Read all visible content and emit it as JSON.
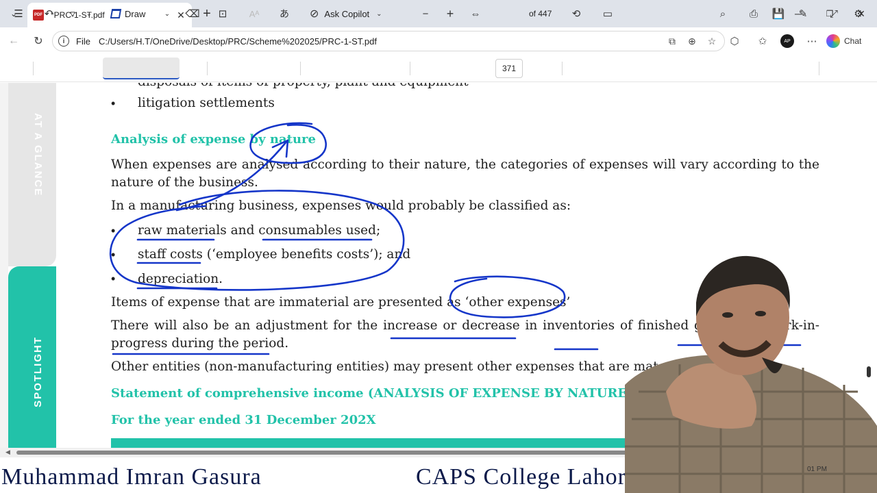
{
  "browser": {
    "tab_title": "*PRC-1-ST.pdf",
    "favicon_text": "PDF",
    "address_label": "File",
    "url": "C:/Users/H.T/OneDrive/Desktop/PRC/Scheme%202025/PRC-1-ST.pdf",
    "chat_label": "Chat",
    "profile_initials": "AP"
  },
  "toolbar": {
    "draw_label": "Draw",
    "copilot_label": "Ask Copilot",
    "current_page": "371",
    "page_total": "of 447"
  },
  "sidebar": {
    "top_label": "AT A GLANCE",
    "bottom_label": "SPOTLIGHT"
  },
  "document": {
    "cut_line": "disposals of items of property, plant and equipment",
    "bullet_litigation": "litigation settlements",
    "heading_analysis": "Analysis of expense by nature",
    "para1_line1": "When expenses are analysed according to their nature, the categories of expenses will vary according to the",
    "para1_line2": "nature of the business.",
    "para2": "In a manufacturing business, expenses would probably be classified as:",
    "bullets": [
      "raw materials and consumables used;",
      "staff costs (‘employee benefits costs’); and",
      "depreciation."
    ],
    "para3": "Items of expense that are immaterial are presented as ‘other expenses’",
    "para4_line1": "There will also be an adjustment for the increase or decrease in inventories of finished goods and work-in-",
    "para4_line2": "progress during the period.",
    "para5": "Other entities (non-manufacturing entities) may present other expenses that are material",
    "heading_statement": "Statement of comprehensive income (ANALYSIS OF EXPENSE BY NATURE)",
    "heading_year": "For the year ended 31 December 202X"
  },
  "overlay": {
    "presenter_name": "Muhammad Imran Gasura",
    "college": "CAPS College Lahore",
    "clock": "01 PM"
  },
  "colors": {
    "accent_teal": "#22c2a9",
    "ink_blue": "#1536c9",
    "caption_navy": "#0c1a4a"
  }
}
